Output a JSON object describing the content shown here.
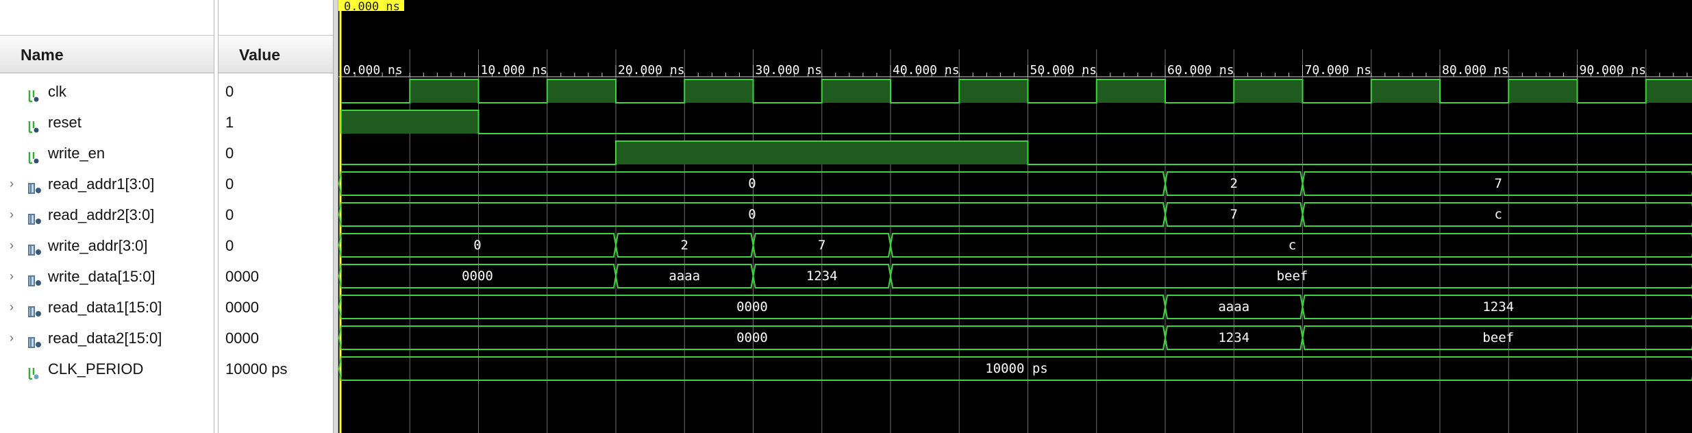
{
  "columns": {
    "name": "Name",
    "value": "Value"
  },
  "cursor": {
    "label": "0.000 ns"
  },
  "signals": [
    {
      "name": "clk",
      "value": "0",
      "kind": "bit",
      "expandable": false
    },
    {
      "name": "reset",
      "value": "1",
      "kind": "bit",
      "expandable": false
    },
    {
      "name": "write_en",
      "value": "0",
      "kind": "bit",
      "expandable": false
    },
    {
      "name": "read_addr1[3:0]",
      "value": "0",
      "kind": "bus",
      "expandable": true
    },
    {
      "name": "read_addr2[3:0]",
      "value": "0",
      "kind": "bus",
      "expandable": true
    },
    {
      "name": "write_addr[3:0]",
      "value": "0",
      "kind": "bus",
      "expandable": true
    },
    {
      "name": "write_data[15:0]",
      "value": "0000",
      "kind": "bus",
      "expandable": true
    },
    {
      "name": "read_data1[15:0]",
      "value": "0000",
      "kind": "bus",
      "expandable": true
    },
    {
      "name": "read_data2[15:0]",
      "value": "0000",
      "kind": "bus",
      "expandable": true
    },
    {
      "name": "CLK_PERIOD",
      "value": "10000 ps",
      "kind": "param",
      "expandable": false
    }
  ],
  "timeline": {
    "start_ns": 0,
    "end_ns": 98.5,
    "ticks": [
      {
        "t": 0,
        "label": "0.000 ns"
      },
      {
        "t": 10,
        "label": "10.000 ns"
      },
      {
        "t": 20,
        "label": "20.000 ns"
      },
      {
        "t": 30,
        "label": "30.000 ns"
      },
      {
        "t": 40,
        "label": "40.000 ns"
      },
      {
        "t": 50,
        "label": "50.000 ns"
      },
      {
        "t": 60,
        "label": "60.000 ns"
      },
      {
        "t": 70,
        "label": "70.000 ns"
      },
      {
        "t": 80,
        "label": "80.000 ns"
      },
      {
        "t": 90,
        "label": "90.000 ns"
      }
    ]
  },
  "waveforms": {
    "clk": {
      "high_intervals_ns": [
        [
          5,
          10
        ],
        [
          15,
          20
        ],
        [
          25,
          30
        ],
        [
          35,
          40
        ],
        [
          45,
          50
        ],
        [
          55,
          60
        ],
        [
          65,
          70
        ],
        [
          75,
          80
        ],
        [
          85,
          90
        ],
        [
          95,
          98.5
        ]
      ]
    },
    "reset": {
      "high_intervals_ns": [
        [
          0,
          10
        ]
      ]
    },
    "write_en": {
      "high_intervals_ns": [
        [
          20,
          50
        ]
      ]
    },
    "read_addr1[3:0]": [
      {
        "from": 0,
        "to": 60,
        "label": "0"
      },
      {
        "from": 60,
        "to": 70,
        "label": "2"
      },
      {
        "from": 70,
        "to": 98.5,
        "label": "7"
      }
    ],
    "read_addr2[3:0]": [
      {
        "from": 0,
        "to": 60,
        "label": "0"
      },
      {
        "from": 60,
        "to": 70,
        "label": "7"
      },
      {
        "from": 70,
        "to": 98.5,
        "label": "c"
      }
    ],
    "write_addr[3:0]": [
      {
        "from": 0,
        "to": 20,
        "label": "0"
      },
      {
        "from": 20,
        "to": 30,
        "label": "2"
      },
      {
        "from": 30,
        "to": 40,
        "label": "7"
      },
      {
        "from": 40,
        "to": 98.5,
        "label": "c"
      }
    ],
    "write_data[15:0]": [
      {
        "from": 0,
        "to": 20,
        "label": "0000"
      },
      {
        "from": 20,
        "to": 30,
        "label": "aaaa"
      },
      {
        "from": 30,
        "to": 40,
        "label": "1234"
      },
      {
        "from": 40,
        "to": 98.5,
        "label": "beef"
      }
    ],
    "read_data1[15:0]": [
      {
        "from": 0,
        "to": 60,
        "label": "0000"
      },
      {
        "from": 60,
        "to": 70,
        "label": "aaaa"
      },
      {
        "from": 70,
        "to": 98.5,
        "label": "1234"
      }
    ],
    "read_data2[15:0]": [
      {
        "from": 0,
        "to": 60,
        "label": "0000"
      },
      {
        "from": 60,
        "to": 70,
        "label": "1234"
      },
      {
        "from": 70,
        "to": 98.5,
        "label": "beef"
      }
    ],
    "CLK_PERIOD": [
      {
        "from": 0,
        "to": 98.5,
        "label": "10000 ps"
      }
    ]
  },
  "colors": {
    "wave_background": "#000000",
    "signal_line": "#3fd23f",
    "high_fill": "#1f5a1f",
    "grid": "#6e6e6e",
    "cursor": "#ffff33",
    "text": "#ffffff"
  }
}
